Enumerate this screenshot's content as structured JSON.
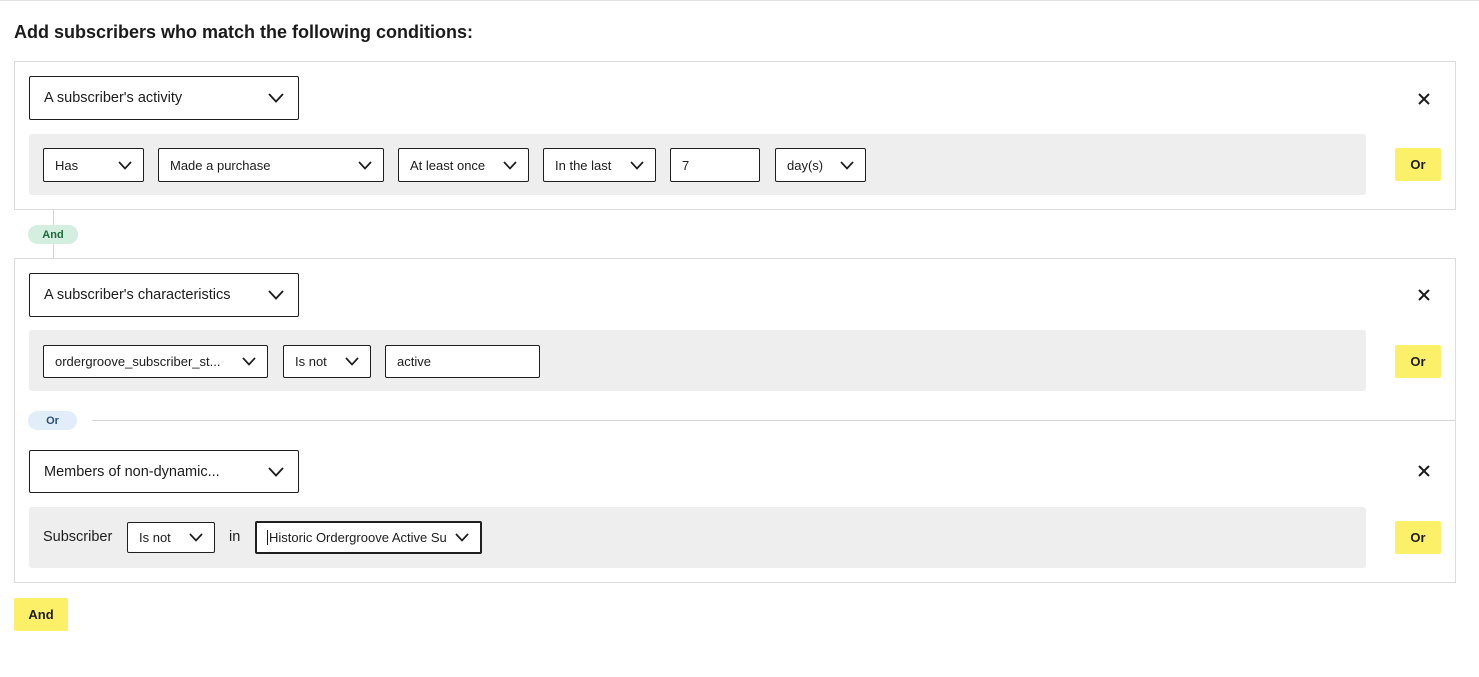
{
  "heading": "Add subscribers who match the following conditions:",
  "groups": [
    {
      "condition_type": "A subscriber's activity",
      "row": {
        "verb": "Has",
        "action": "Made a purchase",
        "frequency": "At least once",
        "timeframe": "In the last",
        "amount": "7",
        "unit": "day(s)"
      },
      "or_label": "Or"
    },
    {
      "condition_type": "A subscriber's characteristics",
      "row": {
        "property": "ordergroove_subscriber_st...",
        "operator": "Is not",
        "value": "active"
      },
      "or_label": "Or"
    },
    {
      "condition_type": "Members of non-dynamic...",
      "row": {
        "subject": "Subscriber",
        "operator": "Is not",
        "in_label": "in",
        "list": "Historic Ordergroove Active Su"
      },
      "or_label": "Or"
    }
  ],
  "connector_and": "And",
  "connector_or": "Or",
  "add_and_label": "And",
  "icons": {
    "dropdown": "chevron-down-icon",
    "remove": "close-icon"
  },
  "colors": {
    "accent_button": "#fdf069",
    "row_background": "#edeeed",
    "and_pill": "#d4eee0",
    "or_pill": "#e1edf9"
  }
}
